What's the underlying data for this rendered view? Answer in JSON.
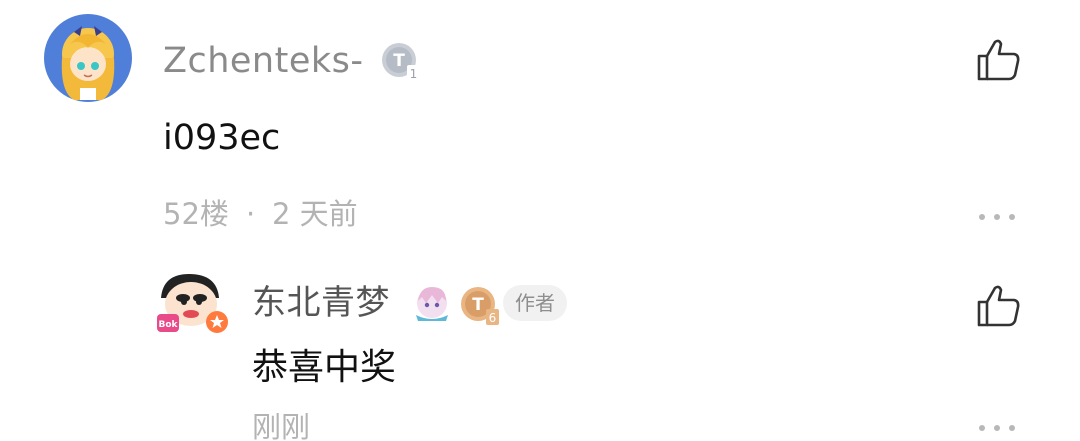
{
  "comment": {
    "username": "Zchenteks-",
    "level": "1",
    "text": "i093ec",
    "floor": "52楼",
    "separator": "·",
    "time": "2 天前",
    "avatar_icon": "anime-girl-avatar",
    "like_icon": "thumbs-up-icon",
    "more_icon": "more-dots-icon"
  },
  "reply": {
    "username": "东北青梦",
    "level": "6",
    "author_tag": "作者",
    "text": "恭喜中奖",
    "time": "刚刚",
    "avatar_icon": "cartoon-boy-avatar",
    "decoration_icon": "anime-character-badge",
    "like_icon": "thumbs-up-icon",
    "more_icon": "more-dots-icon"
  },
  "colors": {
    "username": "#8a8a8a",
    "meta": "#b3b3b3",
    "silver_badge": "#c9ced6",
    "gold_badge": "#e8b583",
    "author_tag_bg": "#f1f1f1"
  }
}
